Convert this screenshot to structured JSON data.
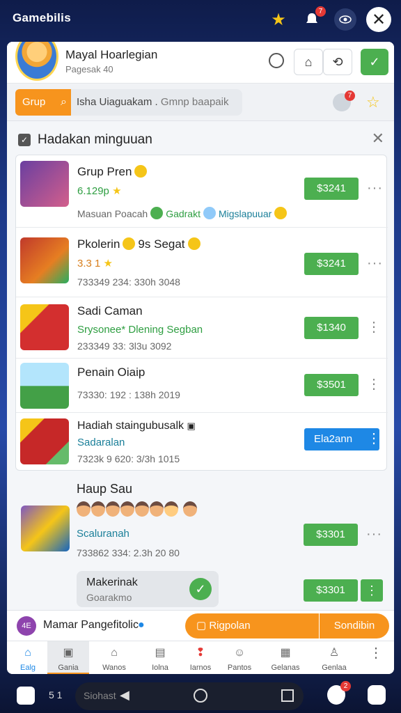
{
  "status_bar": {
    "title": "Gamebilis",
    "notif_badge": "7"
  },
  "profile": {
    "name": "Mayal Hoarlegian",
    "subtitle": "Pagesak 40"
  },
  "search": {
    "chip_label": "Grup",
    "query": "Isha Uiaguakam .",
    "query_muted": "Gmnp baapaik",
    "bot_badge": "7"
  },
  "section": {
    "title": "Hadakan minguuan"
  },
  "items": [
    {
      "title": "Grup Pren",
      "line2": "6.129p",
      "line3_a": "Masuan Poacah",
      "line3_b": "Gadrakt",
      "line3_c": "Migslapuuar",
      "price": "$3241"
    },
    {
      "title": "Pkolerin",
      "title_b": "9s Segat",
      "line2": "3.3 1",
      "line3": "733349 234: 330h 3048",
      "price": "$3241"
    },
    {
      "title": "Sadi Caman",
      "line2": "Srysonee* Dlening Segban",
      "line3": "233349 33: 3l3u 3092",
      "price": "$1340"
    },
    {
      "title": "Penain Oiaip",
      "line3": "73330: 192 : 138h 2019",
      "price": "$3501"
    },
    {
      "title": "Hadiah staingubusalk",
      "line2": "Sadaralan",
      "line3": "7323k 9 620: 3/3h 1015",
      "price": "Ela2ann"
    }
  ],
  "group2": {
    "title": "Haup Sau",
    "line2": "Scaluranah",
    "line3": "733862 334: 2.3h 20 80",
    "price": "$3301",
    "maker_title": "Makerinak",
    "maker_sub": "Goarakmo"
  },
  "footer": {
    "pin_label": "4E",
    "text": "Mamar Pangefitolic",
    "btn_left": "Rigpolan",
    "btn_right": "Sondibin"
  },
  "nav": [
    {
      "label": "Ealg"
    },
    {
      "label": "Gania"
    },
    {
      "label": "Wanos"
    },
    {
      "label": "Iolna"
    },
    {
      "label": "Iarnos"
    },
    {
      "label": "Pantos"
    },
    {
      "label": "Gelanas"
    },
    {
      "label": "Genlaa"
    }
  ],
  "system": {
    "page": "5 1",
    "pill_text": "Siohast",
    "badge": "2"
  },
  "colors": {
    "accent_orange": "#f7941d",
    "accent_green": "#4caf50",
    "accent_blue": "#1e88e5"
  }
}
